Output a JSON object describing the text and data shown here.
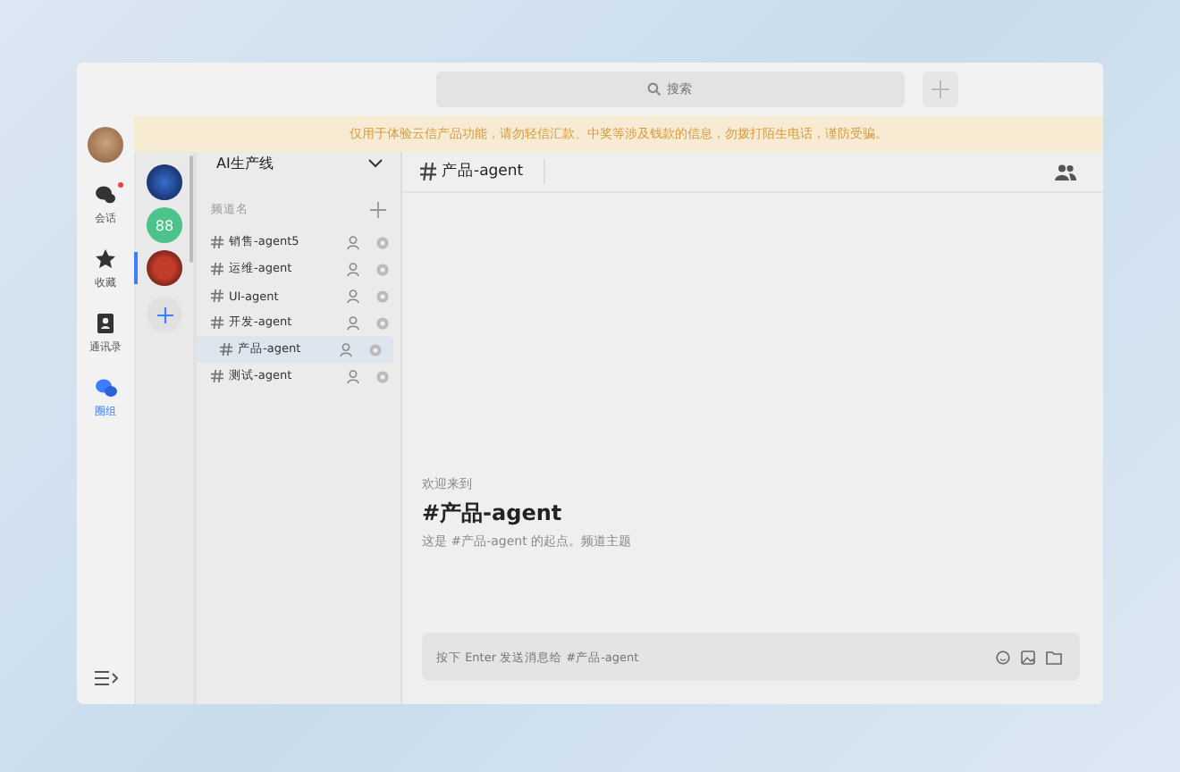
{
  "search": {
    "placeholder": "搜索"
  },
  "banner": "仅用于体验云信产品功能，请勿轻信汇款、中奖等涉及钱款的信息，勿拨打陌生电话，谨防受骗。",
  "nav": [
    {
      "label": "会话",
      "kind": "chat",
      "unread": true,
      "selected": false
    },
    {
      "label": "收藏",
      "kind": "star",
      "unread": false,
      "selected": false
    },
    {
      "label": "通讯录",
      "kind": "contacts",
      "unread": false,
      "selected": false
    },
    {
      "label": "圈组",
      "kind": "circle",
      "unread": false,
      "selected": true
    }
  ],
  "servers": [
    {
      "kind": "photo",
      "selected": false
    },
    {
      "kind": "text",
      "text": "88",
      "color": "#4cc38a",
      "selected": false
    },
    {
      "kind": "photo",
      "selected": true
    }
  ],
  "server_name": "AI生产线",
  "channel_heading": "频道名",
  "channels": [
    {
      "name": "销售-agent5",
      "selected": false
    },
    {
      "name": "运维-agent",
      "selected": false
    },
    {
      "name": "UI-agent",
      "selected": false
    },
    {
      "name": "开发-agent",
      "selected": false
    },
    {
      "name": "产品-agent",
      "selected": true
    },
    {
      "name": "测试-agent",
      "selected": false
    }
  ],
  "header_title": "产品-agent",
  "welcome": {
    "intro": "欢迎来到",
    "title": "#产品-agent",
    "desc": "这是 #产品-agent 的起点。频道主题"
  },
  "composer": {
    "placeholder": "按下 Enter 发送消息给 #产品-agent"
  }
}
